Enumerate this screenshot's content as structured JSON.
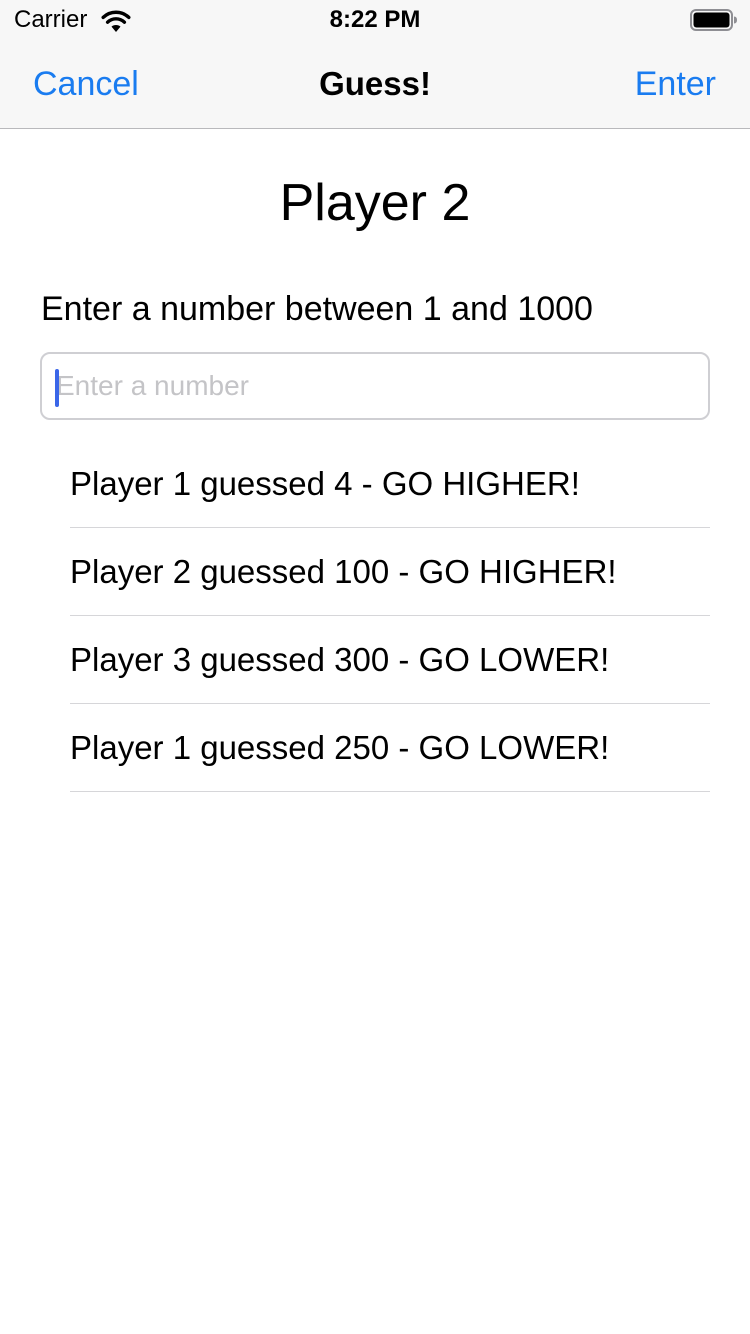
{
  "status_bar": {
    "carrier": "Carrier",
    "time": "8:22 PM",
    "icons": [
      "wifi-icon",
      "battery-icon"
    ]
  },
  "nav": {
    "cancel_label": "Cancel",
    "title": "Guess!",
    "enter_label": "Enter",
    "accent_color": "#1a7cf0"
  },
  "main": {
    "player_title": "Player 2",
    "prompt": "Enter a number between 1 and 1000",
    "input": {
      "value": "",
      "placeholder": "Enter a number"
    },
    "history": [
      "Player 1 guessed 4 - GO HIGHER!",
      "Player 2 guessed 100 - GO HIGHER!",
      "Player 3 guessed 300 - GO LOWER!",
      "Player 1 guessed 250 - GO LOWER!"
    ]
  }
}
